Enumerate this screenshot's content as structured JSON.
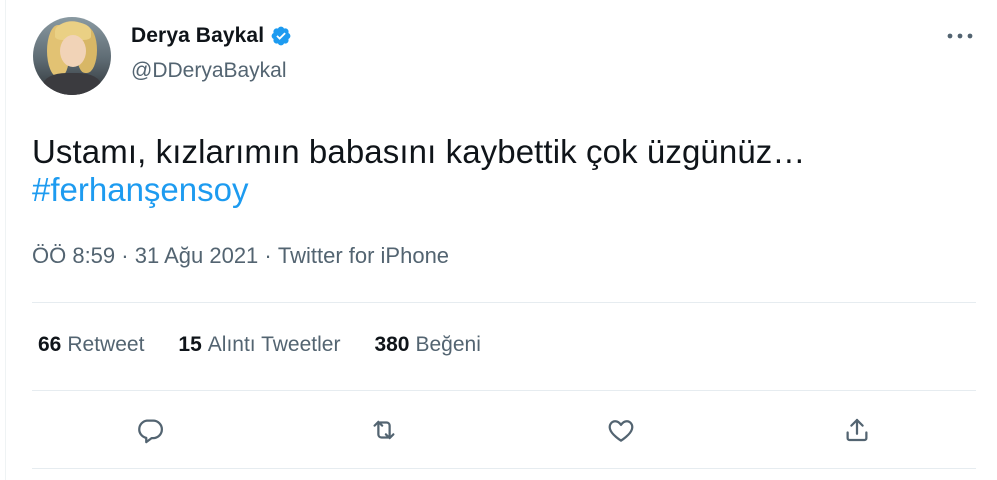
{
  "author": {
    "display_name": "Derya Baykal",
    "handle": "@DDeryaBaykal",
    "verified_icon": "verified-badge-icon"
  },
  "tweet": {
    "text": "Ustamı, kızlarımın babasını kaybettik çok üzgünüz…",
    "hashtag": "#ferhanşensoy",
    "time": "ÖÖ 8:59",
    "separator": " · ",
    "date": "31 Ağu 2021",
    "source": "Twitter for iPhone"
  },
  "stats": [
    {
      "count": "66",
      "label": "Retweet"
    },
    {
      "count": "15",
      "label": "Alıntı Tweetler"
    },
    {
      "count": "380",
      "label": "Beğeni"
    }
  ],
  "actions": {
    "reply_icon": "reply-icon",
    "retweet_icon": "retweet-icon",
    "like_icon": "heart-icon",
    "share_icon": "share-icon",
    "more_icon": "more-icon"
  },
  "colors": {
    "accent": "#1d9bf0",
    "secondary_text": "#536471",
    "primary_text": "#0f1419",
    "divider": "#e6ecf0"
  }
}
